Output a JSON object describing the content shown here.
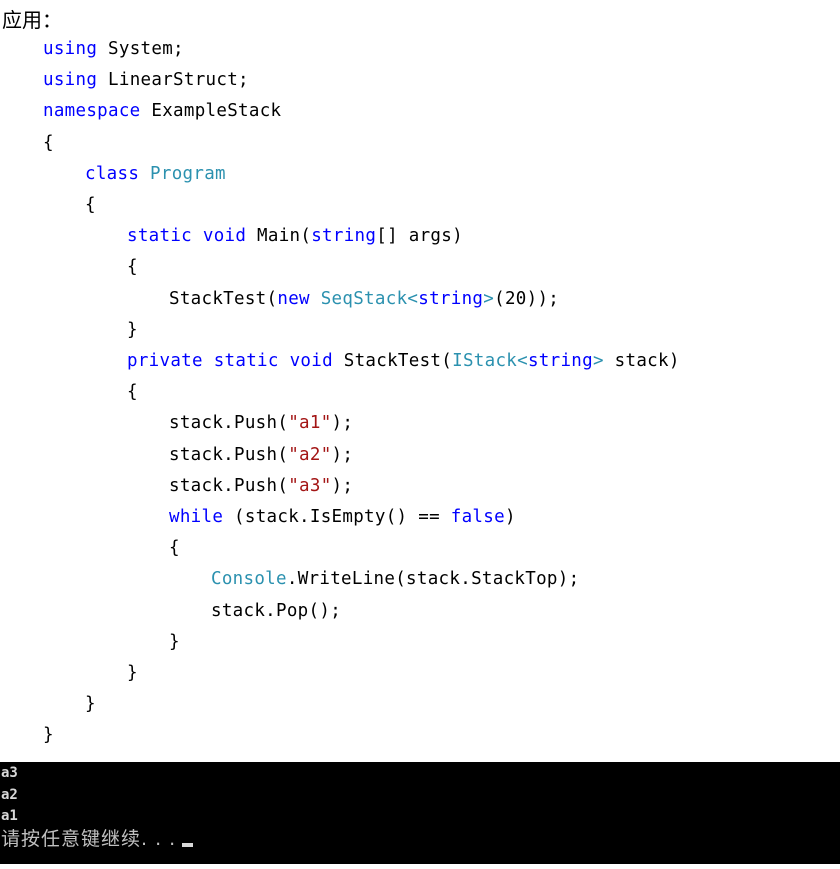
{
  "heading": "应用：",
  "code_lines": [
    {
      "indent": 1,
      "tokens": [
        {
          "t": "using",
          "c": "kw"
        },
        {
          "t": " System;",
          "c": ""
        }
      ]
    },
    {
      "indent": 1,
      "tokens": [
        {
          "t": "using",
          "c": "kw"
        },
        {
          "t": " LinearStruct;",
          "c": ""
        }
      ]
    },
    {
      "indent": 1,
      "tokens": [
        {
          "t": "namespace",
          "c": "kw"
        },
        {
          "t": " ExampleStack",
          "c": ""
        }
      ]
    },
    {
      "indent": 1,
      "tokens": [
        {
          "t": "{",
          "c": ""
        }
      ]
    },
    {
      "indent": 2,
      "tokens": [
        {
          "t": "class",
          "c": "kw"
        },
        {
          "t": " ",
          "c": ""
        },
        {
          "t": "Program",
          "c": "ty"
        }
      ]
    },
    {
      "indent": 2,
      "tokens": [
        {
          "t": "{",
          "c": ""
        }
      ]
    },
    {
      "indent": 3,
      "tokens": [
        {
          "t": "static",
          "c": "kw"
        },
        {
          "t": " ",
          "c": ""
        },
        {
          "t": "void",
          "c": "kw"
        },
        {
          "t": " Main(",
          "c": ""
        },
        {
          "t": "string",
          "c": "kw"
        },
        {
          "t": "[] args)",
          "c": ""
        }
      ]
    },
    {
      "indent": 3,
      "tokens": [
        {
          "t": "{",
          "c": ""
        }
      ]
    },
    {
      "indent": 4,
      "tokens": [
        {
          "t": "StackTest(",
          "c": ""
        },
        {
          "t": "new",
          "c": "kw"
        },
        {
          "t": " ",
          "c": ""
        },
        {
          "t": "SeqStack",
          "c": "ty"
        },
        {
          "t": "<",
          "c": "ty"
        },
        {
          "t": "string",
          "c": "kw"
        },
        {
          "t": ">",
          "c": "ty"
        },
        {
          "t": "(20));",
          "c": ""
        }
      ]
    },
    {
      "indent": 3,
      "tokens": [
        {
          "t": "}",
          "c": ""
        }
      ]
    },
    {
      "indent": 3,
      "tokens": [
        {
          "t": "private",
          "c": "kw"
        },
        {
          "t": " ",
          "c": ""
        },
        {
          "t": "static",
          "c": "kw"
        },
        {
          "t": " ",
          "c": ""
        },
        {
          "t": "void",
          "c": "kw"
        },
        {
          "t": " StackTest(",
          "c": ""
        },
        {
          "t": "IStack",
          "c": "ty"
        },
        {
          "t": "<",
          "c": "ty"
        },
        {
          "t": "string",
          "c": "kw"
        },
        {
          "t": ">",
          "c": "ty"
        },
        {
          "t": " stack)",
          "c": ""
        }
      ]
    },
    {
      "indent": 3,
      "tokens": [
        {
          "t": "{",
          "c": ""
        }
      ]
    },
    {
      "indent": 4,
      "tokens": [
        {
          "t": "stack.Push(",
          "c": ""
        },
        {
          "t": "\"a1\"",
          "c": "st"
        },
        {
          "t": ");",
          "c": ""
        }
      ]
    },
    {
      "indent": 4,
      "tokens": [
        {
          "t": "stack.Push(",
          "c": ""
        },
        {
          "t": "\"a2\"",
          "c": "st"
        },
        {
          "t": ");",
          "c": ""
        }
      ]
    },
    {
      "indent": 4,
      "tokens": [
        {
          "t": "stack.Push(",
          "c": ""
        },
        {
          "t": "\"a3\"",
          "c": "st"
        },
        {
          "t": ");",
          "c": ""
        }
      ]
    },
    {
      "indent": 4,
      "tokens": [
        {
          "t": "while",
          "c": "kw"
        },
        {
          "t": " (stack.IsEmpty() == ",
          "c": ""
        },
        {
          "t": "false",
          "c": "kw"
        },
        {
          "t": ")",
          "c": ""
        }
      ]
    },
    {
      "indent": 4,
      "tokens": [
        {
          "t": "{",
          "c": ""
        }
      ]
    },
    {
      "indent": 5,
      "tokens": [
        {
          "t": "Console",
          "c": "ty"
        },
        {
          "t": ".WriteLine(stack.StackTop);",
          "c": ""
        }
      ]
    },
    {
      "indent": 5,
      "tokens": [
        {
          "t": "stack.Pop();",
          "c": ""
        }
      ]
    },
    {
      "indent": 4,
      "tokens": [
        {
          "t": "}",
          "c": ""
        }
      ]
    },
    {
      "indent": 3,
      "tokens": [
        {
          "t": "}",
          "c": ""
        }
      ]
    },
    {
      "indent": 2,
      "tokens": [
        {
          "t": "}",
          "c": ""
        }
      ]
    },
    {
      "indent": 1,
      "tokens": [
        {
          "t": "}",
          "c": ""
        }
      ]
    }
  ],
  "syntax_colors": {
    "keyword": "#0000ff",
    "type": "#2b91af",
    "string": "#a31515",
    "plain": "#000000"
  },
  "console": {
    "output_lines": [
      "a3",
      "a2",
      "a1"
    ],
    "prompt": "请按任意键继续. . .",
    "background": "#000000"
  }
}
